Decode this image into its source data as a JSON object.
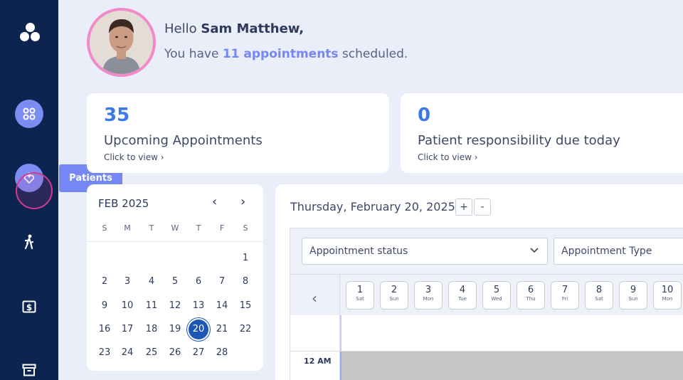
{
  "sidebar": {
    "items": [
      {
        "icon": "logo-icon"
      },
      {
        "icon": "grid-icon"
      },
      {
        "icon": "heart-patients-icon"
      },
      {
        "icon": "walking-icon"
      },
      {
        "icon": "dollar-icon"
      },
      {
        "icon": "archive-icon"
      }
    ],
    "tooltip": "Patients"
  },
  "header": {
    "greeting_prefix": "Hello",
    "user_name": "Sam Matthew,",
    "summary_prefix": "You have",
    "appointments_count": "11 appointments",
    "summary_suffix": "scheduled."
  },
  "stats": [
    {
      "value": "35",
      "label": "Upcoming Appointments",
      "link": "Click to view ›"
    },
    {
      "value": "0",
      "label": "Patient responsibility due today",
      "link": "Click to view ›"
    }
  ],
  "calendar": {
    "month": "FEB 2025",
    "prev": "‹",
    "next": "›",
    "weekdays": [
      "S",
      "M",
      "T",
      "W",
      "T",
      "F",
      "S"
    ],
    "weeks": [
      [
        "",
        "",
        "",
        "",
        "",
        "",
        "1"
      ],
      [
        "2",
        "3",
        "4",
        "5",
        "6",
        "7",
        "8"
      ],
      [
        "9",
        "10",
        "11",
        "12",
        "13",
        "14",
        "15"
      ],
      [
        "16",
        "17",
        "18",
        "19",
        "20",
        "21",
        "22"
      ],
      [
        "23",
        "24",
        "25",
        "26",
        "27",
        "28",
        ""
      ]
    ],
    "selected": "20"
  },
  "schedule": {
    "date": "Thursday, February 20, 2025",
    "zoom_in": "+",
    "zoom_out": "-",
    "status_select": "Appointment status",
    "type_select": "Appointment Type",
    "back": "‹",
    "days": [
      {
        "num": "1",
        "wd": "Sat"
      },
      {
        "num": "2",
        "wd": "Sun"
      },
      {
        "num": "3",
        "wd": "Mon"
      },
      {
        "num": "4",
        "wd": "Tue"
      },
      {
        "num": "5",
        "wd": "Wed"
      },
      {
        "num": "6",
        "wd": "Thu"
      },
      {
        "num": "7",
        "wd": "Fri"
      },
      {
        "num": "8",
        "wd": "Sat"
      },
      {
        "num": "9",
        "wd": "Sun"
      },
      {
        "num": "10",
        "wd": "Mon"
      }
    ],
    "time_label": "12 AM"
  },
  "colors": {
    "sidebar": "#0d2451",
    "accent": "#7587f4",
    "stat_value": "#3b7ae6",
    "selected_day": "#1d56b6",
    "avatar_ring": "#f18acb"
  }
}
